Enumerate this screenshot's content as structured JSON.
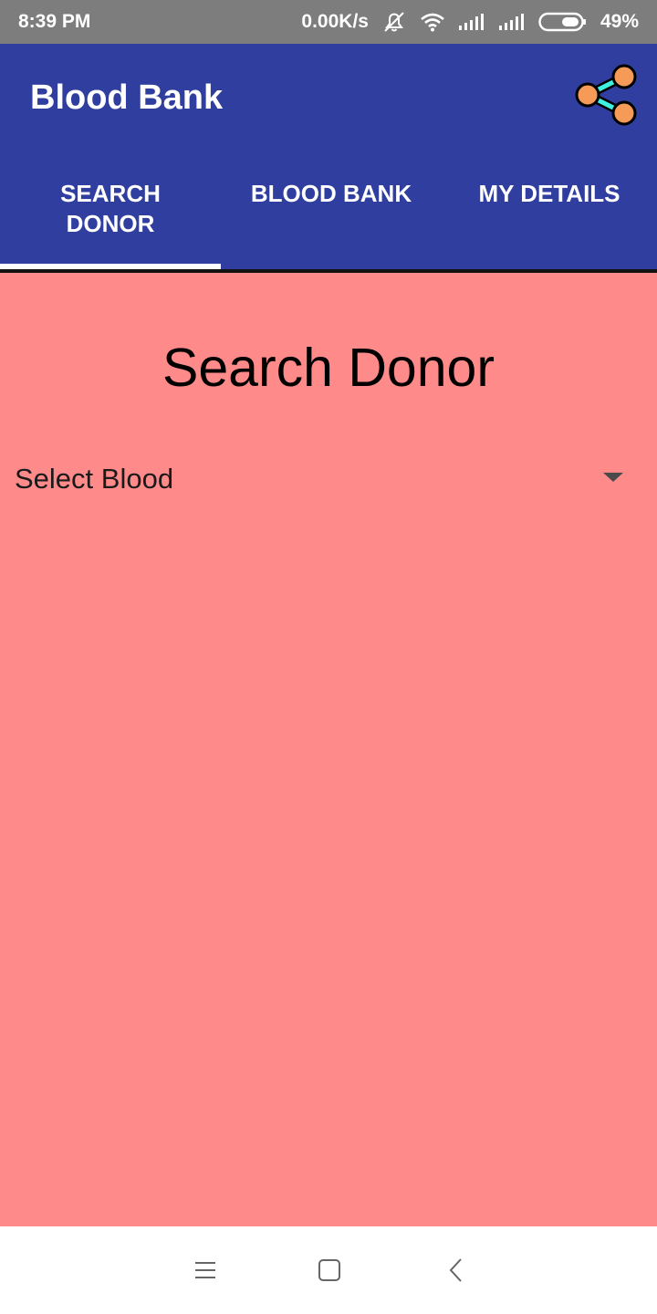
{
  "status_bar": {
    "time": "8:39 PM",
    "network_speed": "0.00K/s",
    "battery": "49%",
    "icons": [
      "mute-icon",
      "wifi-icon",
      "signal-icon",
      "signal-icon",
      "battery-icon"
    ]
  },
  "app_bar": {
    "title": "Blood Bank",
    "share_icon": "share-icon"
  },
  "tabs": [
    {
      "label": "SEARCH DONOR",
      "selected": true
    },
    {
      "label": "BLOOD BANK",
      "selected": false
    },
    {
      "label": "MY DETAILS",
      "selected": false
    }
  ],
  "main": {
    "title": "Search Donor",
    "blood_select": {
      "selected": "Select Blood"
    }
  },
  "nav_bar": {
    "icons": [
      "menu-icon",
      "home-icon",
      "back-icon"
    ]
  },
  "colors": {
    "primary": "#303f9f",
    "content_background": "#ff8a8a",
    "status_bar": "#7d7d7d",
    "share_icon_fill": "#f59b57",
    "share_icon_link": "#3ff0e0"
  }
}
